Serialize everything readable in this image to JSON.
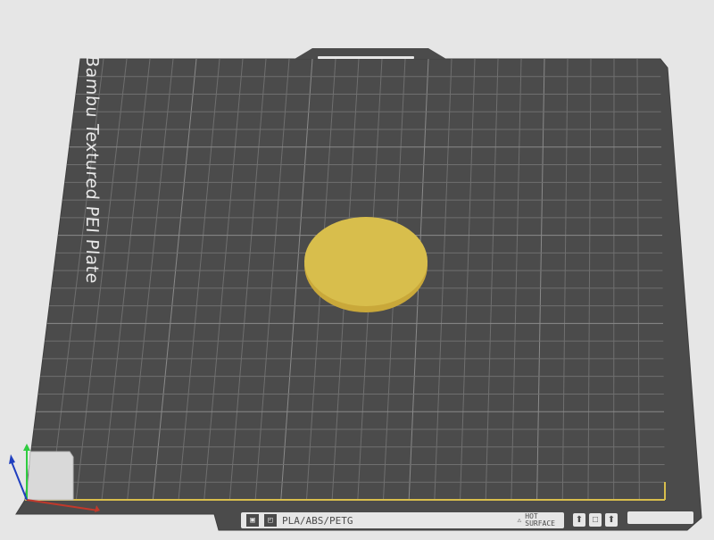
{
  "plate": {
    "name": "Bambu Textured PEI Plate",
    "material_label": "PLA/ABS/PETG",
    "warning_text_1": "HOT",
    "warning_text_2": "SURFACE"
  },
  "colors": {
    "background": "#e6e6e6",
    "plate": "#4b4b4b",
    "grid": "#6f6f6f",
    "object": "#d8be4c",
    "axis_x": "#c0392b",
    "axis_y": "#2ecc40",
    "axis_z": "#1f3fbf"
  },
  "icons": {
    "top_handle": "handle-icon",
    "axes": "axes-gizmo-icon",
    "warning": "warning-triangle-icon"
  }
}
